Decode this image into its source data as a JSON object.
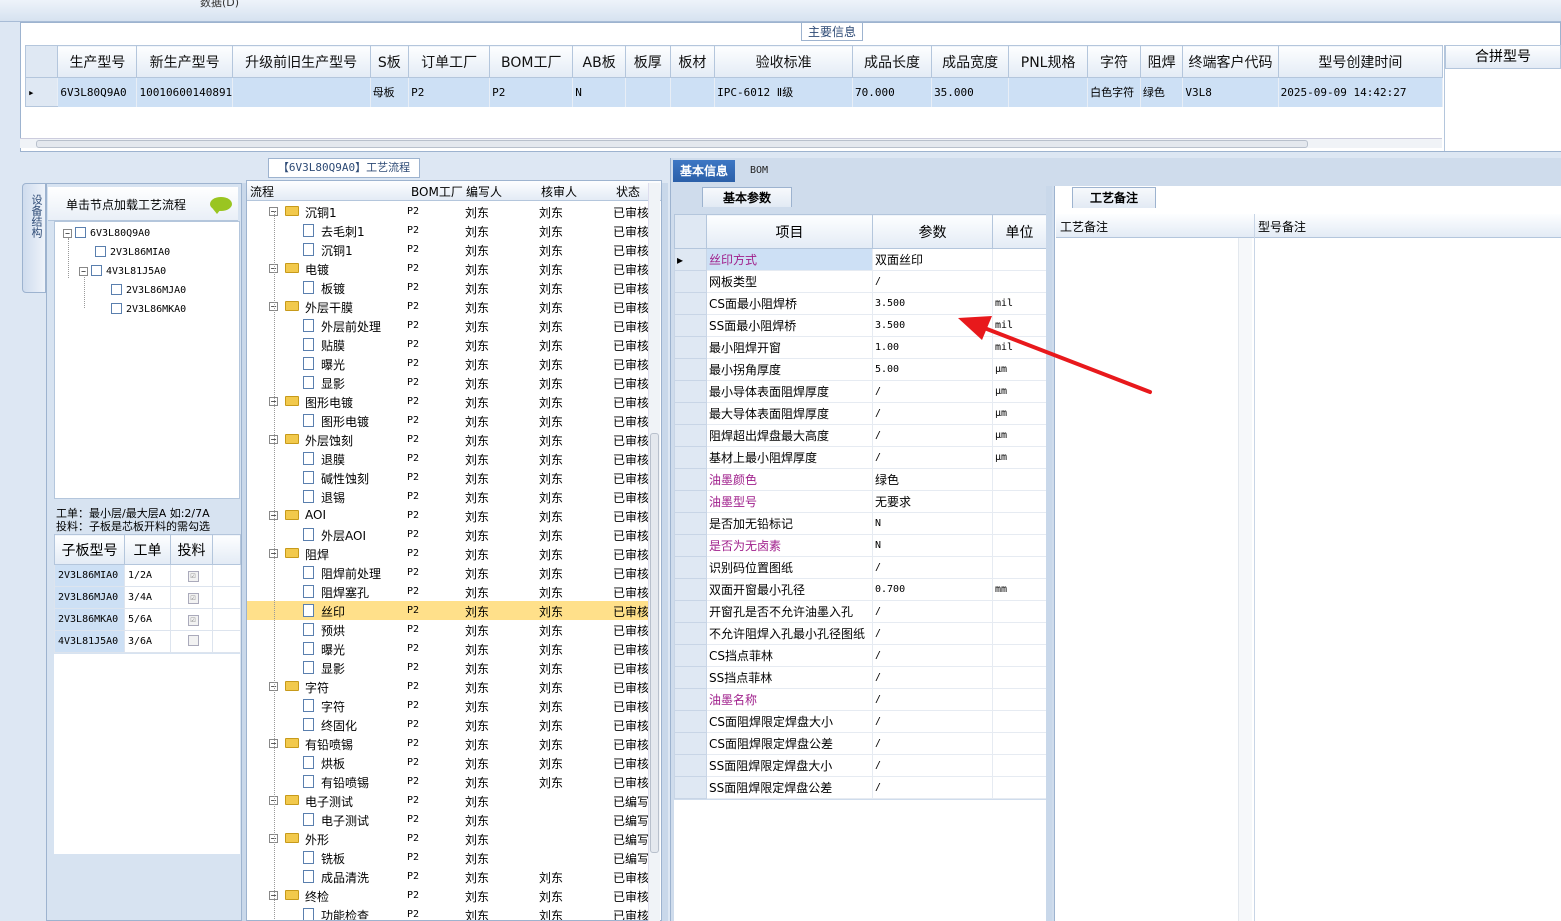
{
  "top": {
    "partial_title": "数据(D)"
  },
  "upper": {
    "title": "主要信息",
    "columns": [
      "生产型号",
      "新生产型号",
      "升级前旧生产型号",
      "S板",
      "订单工厂",
      "BOM工厂",
      "AB板",
      "板厚",
      "板材",
      "验收标准",
      "成品长度",
      "成品宽度",
      "PNL规格",
      "字符",
      "阻焊",
      "终端客户代码",
      "型号创建时间"
    ],
    "row": [
      "6V3L80Q9A0",
      "10010600140891",
      "",
      "母板",
      "P2",
      "P2",
      "N",
      "",
      "",
      "IPC-6012 Ⅱ级",
      "70.000",
      "35.000",
      "",
      "白色字符",
      "绿色",
      "V3L8",
      "2025-09-09 14:42:27"
    ],
    "merge_header": "合拼型号"
  },
  "left": {
    "side_tab": "设备结构",
    "hint": "单击节点加载工艺流程",
    "tree": [
      "6V3L80Q9A0",
      "2V3L86MIA0",
      "4V3L81J5A0",
      "2V3L86MJA0",
      "2V3L86MKA0"
    ],
    "info_line1": "工单：最小层/最大层A 如:2/7A",
    "info_line2": "投料：子板是芯板开料的需勾选",
    "sub_headers": [
      "子板型号",
      "工单",
      "投料"
    ],
    "sub_rows": [
      {
        "model": "2V3L86MIA0",
        "wo": "1/2A",
        "feed": "☑"
      },
      {
        "model": "2V3L86MJA0",
        "wo": "3/4A",
        "feed": "☑"
      },
      {
        "model": "2V3L86MKA0",
        "wo": "5/6A",
        "feed": "☑"
      },
      {
        "model": "4V3L81J5A0",
        "wo": "3/6A",
        "feed": ""
      }
    ]
  },
  "flow": {
    "title": "【6V3L80Q9A0】工艺流程",
    "headers": [
      "流程",
      "BOM工厂",
      "编写人",
      "核审人",
      "状态"
    ],
    "rows": [
      {
        "name": "沉铜1",
        "type": "group",
        "bom": "P2",
        "w": "刘东",
        "r": "刘东",
        "s": "已审核"
      },
      {
        "name": "去毛刺1",
        "type": "child",
        "bom": "P2",
        "w": "刘东",
        "r": "刘东",
        "s": "已审核"
      },
      {
        "name": "沉铜1",
        "type": "child",
        "bom": "P2",
        "w": "刘东",
        "r": "刘东",
        "s": "已审核"
      },
      {
        "name": "电镀",
        "type": "group",
        "bom": "P2",
        "w": "刘东",
        "r": "刘东",
        "s": "已审核"
      },
      {
        "name": "板镀",
        "type": "child",
        "bom": "P2",
        "w": "刘东",
        "r": "刘东",
        "s": "已审核"
      },
      {
        "name": "外层干膜",
        "type": "group",
        "bom": "P2",
        "w": "刘东",
        "r": "刘东",
        "s": "已审核"
      },
      {
        "name": "外层前处理",
        "type": "child",
        "bom": "P2",
        "w": "刘东",
        "r": "刘东",
        "s": "已审核"
      },
      {
        "name": "贴膜",
        "type": "child",
        "bom": "P2",
        "w": "刘东",
        "r": "刘东",
        "s": "已审核"
      },
      {
        "name": "曝光",
        "type": "child",
        "bom": "P2",
        "w": "刘东",
        "r": "刘东",
        "s": "已审核"
      },
      {
        "name": "显影",
        "type": "child",
        "bom": "P2",
        "w": "刘东",
        "r": "刘东",
        "s": "已审核"
      },
      {
        "name": "图形电镀",
        "type": "group",
        "bom": "P2",
        "w": "刘东",
        "r": "刘东",
        "s": "已审核"
      },
      {
        "name": "图形电镀",
        "type": "child",
        "bom": "P2",
        "w": "刘东",
        "r": "刘东",
        "s": "已审核"
      },
      {
        "name": "外层蚀刻",
        "type": "group",
        "bom": "P2",
        "w": "刘东",
        "r": "刘东",
        "s": "已审核"
      },
      {
        "name": "退膜",
        "type": "child",
        "bom": "P2",
        "w": "刘东",
        "r": "刘东",
        "s": "已审核"
      },
      {
        "name": "碱性蚀刻",
        "type": "child",
        "bom": "P2",
        "w": "刘东",
        "r": "刘东",
        "s": "已审核"
      },
      {
        "name": "退锡",
        "type": "child",
        "bom": "P2",
        "w": "刘东",
        "r": "刘东",
        "s": "已审核"
      },
      {
        "name": "AOI",
        "type": "group",
        "bom": "P2",
        "w": "刘东",
        "r": "刘东",
        "s": "已审核"
      },
      {
        "name": "外层AOI",
        "type": "child",
        "bom": "P2",
        "w": "刘东",
        "r": "刘东",
        "s": "已审核"
      },
      {
        "name": "阻焊",
        "type": "group",
        "bom": "P2",
        "w": "刘东",
        "r": "刘东",
        "s": "已审核"
      },
      {
        "name": "阻焊前处理",
        "type": "child",
        "bom": "P2",
        "w": "刘东",
        "r": "刘东",
        "s": "已审核"
      },
      {
        "name": "阻焊塞孔",
        "type": "child",
        "bom": "P2",
        "w": "刘东",
        "r": "刘东",
        "s": "已审核"
      },
      {
        "name": "丝印",
        "type": "child",
        "sel": true,
        "bom": "P2",
        "w": "刘东",
        "r": "刘东",
        "s": "已审核"
      },
      {
        "name": "预烘",
        "type": "child",
        "bom": "P2",
        "w": "刘东",
        "r": "刘东",
        "s": "已审核"
      },
      {
        "name": "曝光",
        "type": "child",
        "bom": "P2",
        "w": "刘东",
        "r": "刘东",
        "s": "已审核"
      },
      {
        "name": "显影",
        "type": "child",
        "bom": "P2",
        "w": "刘东",
        "r": "刘东",
        "s": "已审核"
      },
      {
        "name": "字符",
        "type": "group",
        "bom": "P2",
        "w": "刘东",
        "r": "刘东",
        "s": "已审核"
      },
      {
        "name": "字符",
        "type": "child",
        "bom": "P2",
        "w": "刘东",
        "r": "刘东",
        "s": "已审核"
      },
      {
        "name": "终固化",
        "type": "child",
        "bom": "P2",
        "w": "刘东",
        "r": "刘东",
        "s": "已审核"
      },
      {
        "name": "有铅喷锡",
        "type": "group",
        "bom": "P2",
        "w": "刘东",
        "r": "刘东",
        "s": "已审核"
      },
      {
        "name": "烘板",
        "type": "child",
        "bom": "P2",
        "w": "刘东",
        "r": "刘东",
        "s": "已审核"
      },
      {
        "name": "有铅喷锡",
        "type": "child",
        "bom": "P2",
        "w": "刘东",
        "r": "刘东",
        "s": "已审核"
      },
      {
        "name": "电子测试",
        "type": "group",
        "bom": "P2",
        "w": "刘东",
        "r": "",
        "s": "已编写"
      },
      {
        "name": "电子测试",
        "type": "child",
        "bom": "P2",
        "w": "刘东",
        "r": "",
        "s": "已编写"
      },
      {
        "name": "外形",
        "type": "group",
        "bom": "P2",
        "w": "刘东",
        "r": "",
        "s": "已编写"
      },
      {
        "name": "铣板",
        "type": "child",
        "bom": "P2",
        "w": "刘东",
        "r": "",
        "s": "已编写"
      },
      {
        "name": "成品清洗",
        "type": "child",
        "bom": "P2",
        "w": "刘东",
        "r": "刘东",
        "s": "已审核"
      },
      {
        "name": "终检",
        "type": "group",
        "bom": "P2",
        "w": "刘东",
        "r": "刘东",
        "s": "已审核"
      },
      {
        "name": "功能检查",
        "type": "child",
        "bom": "P2",
        "w": "刘东",
        "r": "刘东",
        "s": "已审核"
      }
    ]
  },
  "right": {
    "tabs": [
      "基本信息",
      "BOM"
    ],
    "subtab": "基本参数",
    "headers": [
      "项目",
      "参数",
      "单位"
    ],
    "rows": [
      {
        "item": "丝印方式",
        "param": "双面丝印",
        "unit": "",
        "purple": true,
        "sel": true
      },
      {
        "item": "网板类型",
        "param": "/",
        "unit": ""
      },
      {
        "item": "CS面最小阻焊桥",
        "param": "3.500",
        "unit": "mil"
      },
      {
        "item": "SS面最小阻焊桥",
        "param": "3.500",
        "unit": "mil"
      },
      {
        "item": "最小阻焊开窗",
        "param": "1.00",
        "unit": "mil"
      },
      {
        "item": "最小拐角厚度",
        "param": "5.00",
        "unit": "μm"
      },
      {
        "item": "最小导体表面阻焊厚度",
        "param": "/",
        "unit": "μm"
      },
      {
        "item": "最大导体表面阻焊厚度",
        "param": "/",
        "unit": "μm"
      },
      {
        "item": "阻焊超出焊盘最大高度",
        "param": "/",
        "unit": "μm"
      },
      {
        "item": "基材上最小阻焊厚度",
        "param": "/",
        "unit": "μm"
      },
      {
        "item": "油墨颜色",
        "param": "绿色",
        "unit": "",
        "purple": true
      },
      {
        "item": "油墨型号",
        "param": "无要求",
        "unit": "",
        "purple": true
      },
      {
        "item": "是否加无铅标记",
        "param": "N",
        "unit": ""
      },
      {
        "item": "是否为无卤素",
        "param": "N",
        "unit": "",
        "purple": true
      },
      {
        "item": "识别码位置图纸",
        "param": "/",
        "unit": ""
      },
      {
        "item": "双面开窗最小孔径",
        "param": "0.700",
        "unit": "mm"
      },
      {
        "item": "开窗孔是否不允许油墨入孔",
        "param": "/",
        "unit": ""
      },
      {
        "item": "不允许阻焊入孔最小孔径图纸",
        "param": "/",
        "unit": ""
      },
      {
        "item": "CS挡点菲林",
        "param": "/",
        "unit": ""
      },
      {
        "item": "SS挡点菲林",
        "param": "/",
        "unit": ""
      },
      {
        "item": "油墨名称",
        "param": "/",
        "unit": "",
        "purple": true
      },
      {
        "item": "CS面阻焊限定焊盘大小",
        "param": "/",
        "unit": ""
      },
      {
        "item": "CS面阻焊限定焊盘公差",
        "param": "/",
        "unit": ""
      },
      {
        "item": "SS面阻焊限定焊盘大小",
        "param": "/",
        "unit": ""
      },
      {
        "item": "SS面阻焊限定焊盘公差",
        "param": "/",
        "unit": ""
      }
    ],
    "notes_tab": "工艺备注",
    "notes_headers": [
      "工艺备注",
      "型号备注"
    ]
  },
  "colors": {
    "accent": "#2b5fa8",
    "selected_row": "#cde0f5",
    "highlight": "#ffe08a",
    "purple_label": "#a0208c",
    "annotation_arrow": "#e8191c"
  }
}
